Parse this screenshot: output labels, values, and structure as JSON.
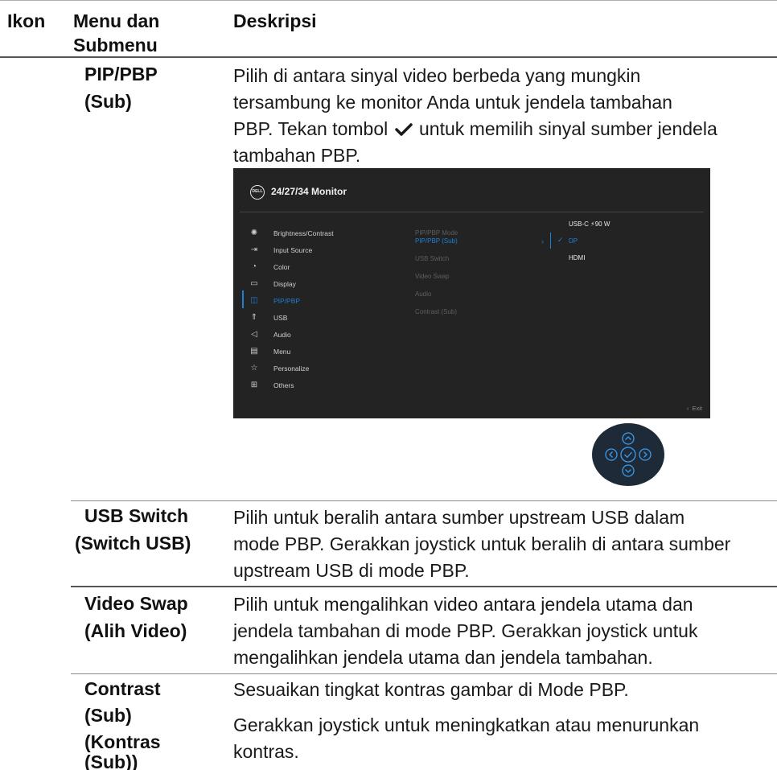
{
  "headers": {
    "icon": "Ikon",
    "menu_line1": "Menu dan",
    "menu_line2": "Submenu",
    "desc": "Deskripsi"
  },
  "rows": [
    {
      "name_lines": [
        "PIP/PBP",
        "(Sub)"
      ],
      "desc_lines": [
        "Pilih di antara sinyal video berbeda yang mungkin",
        "tersambung ke monitor Anda untuk jendela tambahan",
        "PBP. Tekan tombol",
        "untuk memilih sinyal sumber jendela",
        "tambahan PBP."
      ]
    },
    {
      "name_lines": [
        "USB Switch",
        "(Switch USB)"
      ],
      "desc_lines": [
        "Pilih untuk beralih antara sumber upstream USB dalam",
        "mode PBP. Gerakkan joystick untuk beralih di antara sumber",
        "upstream USB di mode PBP."
      ]
    },
    {
      "name_lines": [
        "Video Swap",
        "(Alih Video)"
      ],
      "desc_lines": [
        "Pilih untuk mengalihkan video antara jendela utama dan",
        "jendela tambahan di mode PBP. Gerakkan joystick untuk",
        "mengalihkan jendela utama dan jendela tambahan."
      ]
    },
    {
      "name_lines": [
        "Contrast",
        "(Sub)",
        "(Kontras",
        "(Sub))"
      ],
      "desc_lines": [
        "Sesuaikan tingkat kontras gambar di Mode PBP.",
        "Gerakkan joystick untuk meningkatkan atau menurunkan",
        "kontras."
      ]
    }
  ],
  "osd": {
    "logo": "DELL",
    "title": "24/27/34 Monitor",
    "menu": [
      {
        "icon": "brightness-icon",
        "glyph": "✺",
        "label": "Brightness/Contrast"
      },
      {
        "icon": "input-source-icon",
        "glyph": "⇥",
        "label": "Input Source"
      },
      {
        "icon": "color-icon",
        "glyph": "◔",
        "label": "Color"
      },
      {
        "icon": "display-icon",
        "glyph": "▭",
        "label": "Display"
      },
      {
        "icon": "pip-pbp-icon",
        "glyph": "◫",
        "label": "PIP/PBP"
      },
      {
        "icon": "usb-icon",
        "glyph": "⇑",
        "label": "USB"
      },
      {
        "icon": "audio-icon",
        "glyph": "◁",
        "label": "Audio"
      },
      {
        "icon": "menu-icon",
        "glyph": "▤",
        "label": "Menu"
      },
      {
        "icon": "star-icon",
        "glyph": "☆",
        "label": "Personalize"
      },
      {
        "icon": "others-icon",
        "glyph": "⊞",
        "label": "Others"
      }
    ],
    "submenu": [
      "PIP/PBP Mode",
      "PIP/PBP (Sub)",
      "USB Switch",
      "Video Swap",
      "Audio",
      "Contrast (Sub)"
    ],
    "options": [
      "USB-C ⚡90 W",
      "DP",
      "HDMI"
    ],
    "exit": "Exit",
    "accent": "#1e7fd6"
  }
}
